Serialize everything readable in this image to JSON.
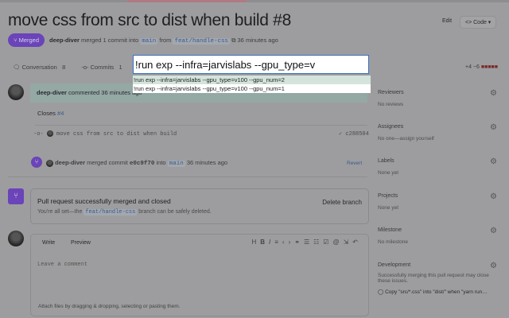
{
  "title": "move css from src to dist when build #8",
  "header": {
    "edit": "Edit",
    "code": "<> Code ▾"
  },
  "status": {
    "badge": "Merged",
    "author": "deep-diver",
    "text": "merged 1 commit into",
    "base": "main",
    "from": "from",
    "head": "feat/handle-css",
    "time": "36 minutes ago"
  },
  "tabs": [
    {
      "label": "Conversation",
      "count": "8"
    },
    {
      "label": "Commits",
      "count": "1"
    }
  ],
  "diffstat": "+4 −6",
  "command": {
    "value": "!run exp --infra=jarvislabs --gpu_type=v",
    "suggestions": [
      "!run exp --infra=jarvislabs --gpu_type=v100 --gpu_num=2",
      "!run exp --infra=jarvislabs --gpu_type=v100 --gpu_num=1"
    ]
  },
  "comment": {
    "author": "deep-diver",
    "text": "commented 36 minutes ago",
    "body": "Closes",
    "ref": "#4"
  },
  "commit": {
    "message": "move css from src to dist when build",
    "sha": "✓ c288504"
  },
  "merge_event": {
    "author": "deep-diver",
    "text": "merged commit",
    "sha": "e0c9f70",
    "into": "into",
    "base": "main",
    "time": "36 minutes ago",
    "revert": "Revert"
  },
  "merge_box": {
    "title": "Pull request successfully merged and closed",
    "desc1": "You're all set—the",
    "branch": "feat/handle-css",
    "desc2": "branch can be safely deleted.",
    "delete": "Delete branch"
  },
  "form": {
    "write": "Write",
    "preview": "Preview",
    "placeholder": "Leave a comment",
    "attach": "Attach files by dragging & dropping, selecting or pasting them."
  },
  "sidebar": [
    {
      "h": "Reviewers",
      "v": "No reviews"
    },
    {
      "h": "Assignees",
      "v": "No one—assign yourself"
    },
    {
      "h": "Labels",
      "v": "None yet"
    },
    {
      "h": "Projects",
      "v": "None yet"
    },
    {
      "h": "Milestone",
      "v": "No milestone"
    },
    {
      "h": "Development",
      "v": "Successfully merging this pull request may close these issues."
    }
  ],
  "dev_issue": "Copy \"src/*.css\" into \"dist/\" when \"yarn run…"
}
